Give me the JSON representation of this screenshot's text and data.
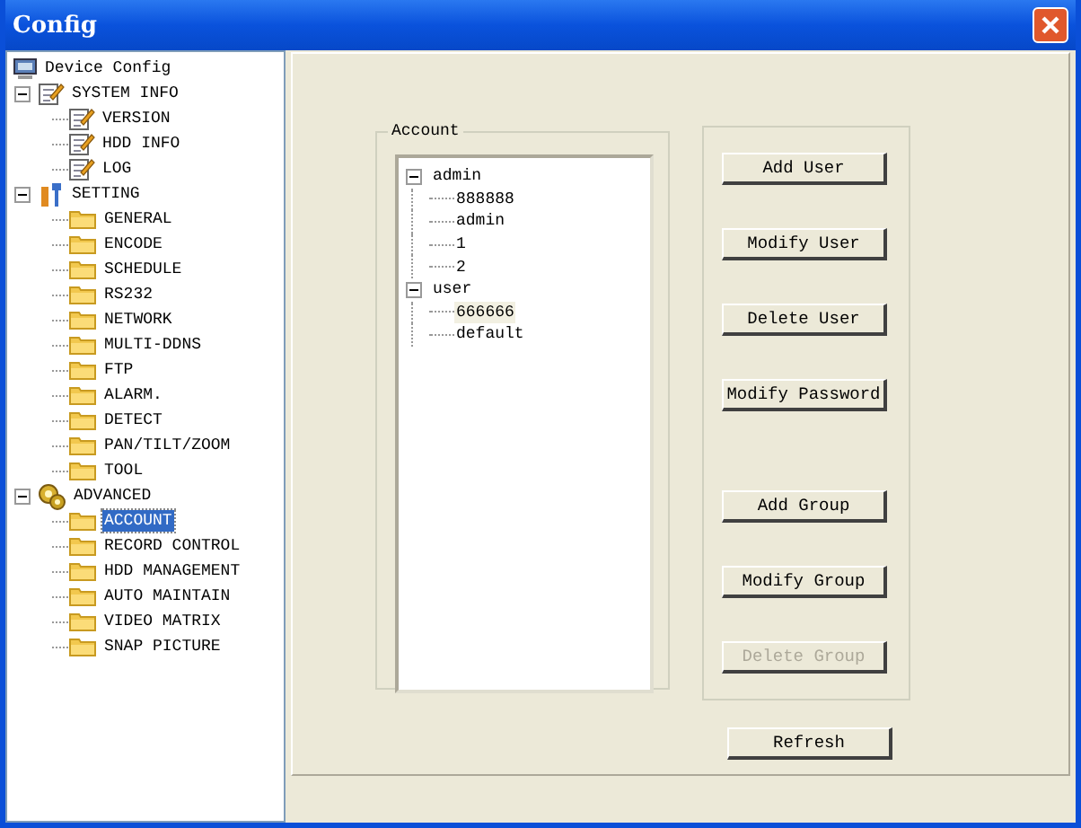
{
  "window": {
    "title": "Config"
  },
  "tree": [
    {
      "label": "Device Config",
      "kind": "computer",
      "selected": false,
      "children": [
        {
          "label": "SYSTEM INFO",
          "kind": "note",
          "selected": false,
          "expanded": true,
          "children": [
            {
              "label": "VERSION",
              "kind": "note",
              "selected": false
            },
            {
              "label": "HDD INFO",
              "kind": "note",
              "selected": false
            },
            {
              "label": "LOG",
              "kind": "note",
              "selected": false
            }
          ]
        },
        {
          "label": "SETTING",
          "kind": "tool",
          "selected": false,
          "expanded": true,
          "children": [
            {
              "label": "GENERAL",
              "kind": "folder",
              "selected": false
            },
            {
              "label": "ENCODE",
              "kind": "folder",
              "selected": false
            },
            {
              "label": "SCHEDULE",
              "kind": "folder",
              "selected": false
            },
            {
              "label": "RS232",
              "kind": "folder",
              "selected": false
            },
            {
              "label": "NETWORK",
              "kind": "folder",
              "selected": false
            },
            {
              "label": "MULTI-DDNS",
              "kind": "folder",
              "selected": false
            },
            {
              "label": "FTP",
              "kind": "folder",
              "selected": false
            },
            {
              "label": "ALARM.",
              "kind": "folder",
              "selected": false
            },
            {
              "label": "DETECT",
              "kind": "folder",
              "selected": false
            },
            {
              "label": "PAN/TILT/ZOOM",
              "kind": "folder",
              "selected": false
            },
            {
              "label": "TOOL",
              "kind": "folder",
              "selected": false
            }
          ]
        },
        {
          "label": "ADVANCED",
          "kind": "gears",
          "selected": false,
          "expanded": true,
          "children": [
            {
              "label": "ACCOUNT",
              "kind": "folder",
              "selected": true
            },
            {
              "label": "RECORD CONTROL",
              "kind": "folder",
              "selected": false
            },
            {
              "label": "HDD MANAGEMENT",
              "kind": "folder",
              "selected": false
            },
            {
              "label": "AUTO MAINTAIN",
              "kind": "folder",
              "selected": false
            },
            {
              "label": "VIDEO MATRIX",
              "kind": "folder",
              "selected": false
            },
            {
              "label": "SNAP PICTURE",
              "kind": "folder",
              "selected": false
            }
          ]
        }
      ]
    }
  ],
  "account": {
    "title": "Account",
    "groups": [
      {
        "name": "admin",
        "expanded": true,
        "users": [
          {
            "name": "888888",
            "selected": false
          },
          {
            "name": "admin",
            "selected": false
          },
          {
            "name": "1",
            "selected": false
          },
          {
            "name": "2",
            "selected": false
          }
        ]
      },
      {
        "name": "user",
        "expanded": true,
        "users": [
          {
            "name": "666666",
            "selected": true
          },
          {
            "name": "default",
            "selected": false
          }
        ]
      }
    ]
  },
  "user_buttons": [
    {
      "label": "Add User",
      "disabled": false
    },
    {
      "label": "Modify User",
      "disabled": false
    },
    {
      "label": "Delete User",
      "disabled": false
    },
    {
      "label": "Modify Password",
      "disabled": false
    }
  ],
  "group_buttons": [
    {
      "label": "Add Group",
      "disabled": false
    },
    {
      "label": "Modify Group",
      "disabled": false
    },
    {
      "label": "Delete Group",
      "disabled": true
    }
  ],
  "refresh_button": {
    "label": "Refresh",
    "disabled": false
  }
}
